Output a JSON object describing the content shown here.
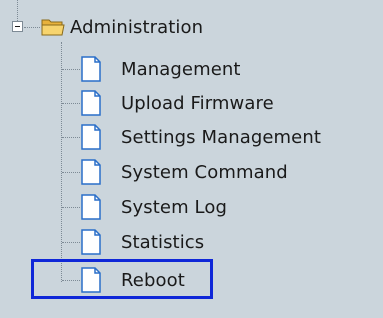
{
  "tree": {
    "root": {
      "label": "Administration"
    },
    "items": [
      {
        "label": "Management"
      },
      {
        "label": "Upload Firmware"
      },
      {
        "label": "Settings Management"
      },
      {
        "label": "System Command"
      },
      {
        "label": "System Log"
      },
      {
        "label": "Statistics"
      },
      {
        "label": "Reboot",
        "highlighted": true
      }
    ]
  },
  "colors": {
    "background": "#cbd5dc",
    "highlight_border": "#0f27d8",
    "folder": "#f4c95a"
  }
}
